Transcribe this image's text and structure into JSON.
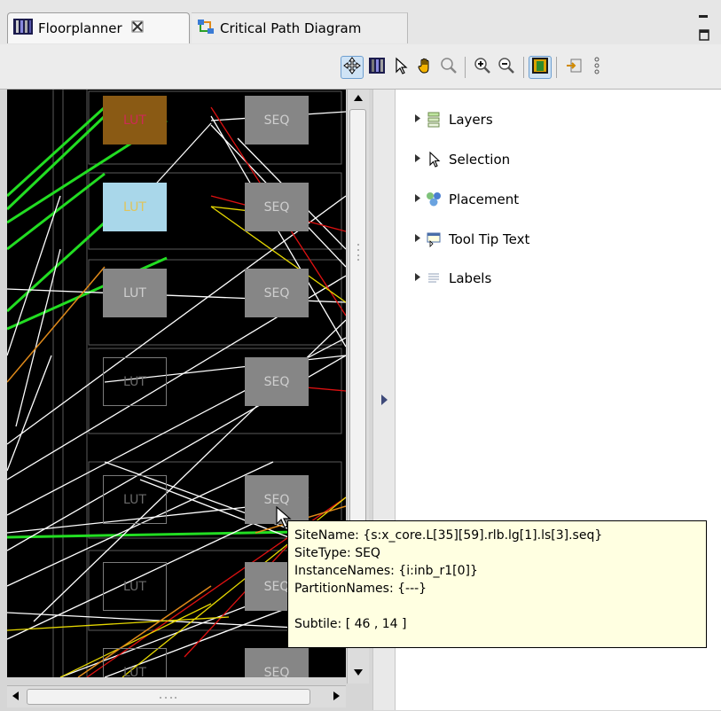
{
  "tabs": [
    {
      "label": "Floorplanner",
      "icon": "floorplanner-icon",
      "active": true,
      "close": "close-tab-icon"
    },
    {
      "label": "Critical Path Diagram",
      "icon": "critical-path-icon",
      "active": false
    }
  ],
  "toolbar": {
    "tools": [
      "move-icon",
      "color-map-icon",
      "select-arrow-icon",
      "pan-hand-icon",
      "magnifier-icon",
      "zoom-in-icon",
      "zoom-out-icon",
      "highlight-icon",
      "export-icon",
      "more-icon"
    ]
  },
  "canvas": {
    "cells": [
      {
        "label": "LUT",
        "style": "brown"
      },
      {
        "label": "SEQ",
        "style": "gray"
      },
      {
        "label": "LUT",
        "style": "lightblue"
      },
      {
        "label": "SEQ",
        "style": "gray"
      },
      {
        "label": "LUT",
        "style": "gray"
      },
      {
        "label": "SEQ",
        "style": "gray"
      },
      {
        "label": "LUT",
        "style": "outline"
      },
      {
        "label": "SEQ",
        "style": "gray"
      },
      {
        "label": "LUT",
        "style": "outline"
      },
      {
        "label": "SEQ",
        "style": "gray"
      },
      {
        "label": "LUT",
        "style": "outline"
      },
      {
        "label": "SEQ",
        "style": "gray"
      },
      {
        "label": "LUT",
        "style": "outline"
      },
      {
        "label": "SEQ",
        "style": "gray"
      }
    ],
    "colors": {
      "background": "#000000",
      "white_nets": "#ffffff",
      "green_nets": "#22dd22",
      "red_nets": "#dd1111",
      "yellow_nets": "#e5d700",
      "orange_nets": "#e08a1a"
    }
  },
  "palette": {
    "drawers": [
      {
        "label": "Layers",
        "icon": "layers-icon"
      },
      {
        "label": "Selection",
        "icon": "selection-arrow-icon"
      },
      {
        "label": "Placement",
        "icon": "placement-icon"
      },
      {
        "label": "Tool Tip Text",
        "icon": "tooltip-text-icon"
      },
      {
        "label": "Labels",
        "icon": "labels-icon"
      }
    ]
  },
  "tooltip": {
    "site_name": "SiteName: {s:x_core.L[35][59].rlb.lg[1].ls[3].seq}",
    "site_type": "SiteType: SEQ",
    "instance_names": "InstanceNames: {i:inb_r1[0]}",
    "partition_names": "PartitionNames: {---}",
    "subtile": "Subtile: [ 46 , 14 ]"
  }
}
